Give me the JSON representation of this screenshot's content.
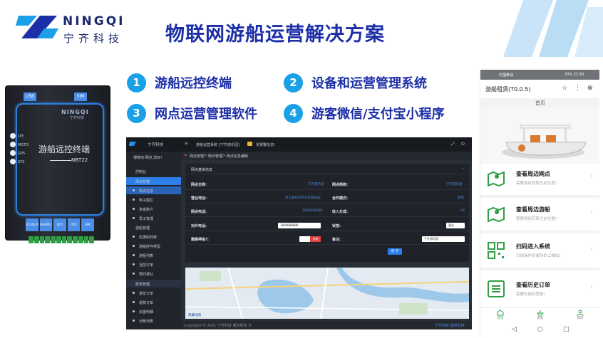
{
  "brand": {
    "name_en": "NINGQI",
    "name_cn": "宁齐科技"
  },
  "title": "物联网游船运营解决方案",
  "colors": {
    "accent": "#1c2fa6",
    "badge": "#1aa0e6",
    "green": "#2f9e44",
    "blue": "#2d7ee8"
  },
  "features": [
    {
      "num": "1",
      "label": "游船远控终端"
    },
    {
      "num": "2",
      "label": "设备和运营管理系统"
    },
    {
      "num": "3",
      "label": "网点运营管理软件"
    },
    {
      "num": "4",
      "label": "游客微信/支付宝小程序"
    }
  ],
  "device": {
    "ports": [
      "USB",
      "SIM"
    ],
    "brand": "NINGQI",
    "brand_sub": "宁齐科技",
    "name": "游船远控终端",
    "model": "NBT22",
    "leds": [
      "LTE",
      "MOTO",
      "GPS",
      "SYS"
    ],
    "bottom_labels": [
      "DC24V IN",
      "ALARM OUT",
      "DO1",
      "DO2",
      "EPK"
    ]
  },
  "web": {
    "logo_text": "宁齐科技",
    "system_title": "游船运营系统",
    "system_sub": "[宁齐游乐园]",
    "notice": "关报警信息!",
    "user": "傅移动-网点,您好!",
    "breadcrumb": [
      "网点管理",
      "网点管理",
      "网点信息编辑"
    ],
    "sidebar": [
      {
        "label": "控制台",
        "type": "group"
      },
      {
        "label": "网点管理",
        "type": "active"
      },
      {
        "label": "网点信息",
        "type": "sub-active"
      },
      {
        "label": "电子围栏",
        "type": "sub"
      },
      {
        "label": "资金账户",
        "type": "sub"
      },
      {
        "label": "员工管理",
        "type": "sub"
      },
      {
        "label": "游船管理",
        "type": "group"
      },
      {
        "label": "优惠码列表",
        "type": "sub"
      },
      {
        "label": "游船控件类型",
        "type": "sub"
      },
      {
        "label": "游船列表",
        "type": "sub"
      },
      {
        "label": "当前订单",
        "type": "sub"
      },
      {
        "label": "预约排队",
        "type": "sub"
      },
      {
        "label": "财务管理",
        "type": "group-hl"
      },
      {
        "label": "游览订单",
        "type": "sub"
      },
      {
        "label": "退款订单",
        "type": "sub"
      },
      {
        "label": "资金明细",
        "type": "sub"
      },
      {
        "label": "分账列表",
        "type": "sub"
      }
    ],
    "panel_title": "网点基本信息",
    "fields": {
      "full_name_label": "网点全称:",
      "full_name_value": "宁齐游乐园",
      "short_name_label": "网点简称:",
      "short_name_value": "宁齐游乐园",
      "address_label": "营业地址:",
      "address_value": "浙江省杭州市宁齐游乐园",
      "coop_label": "合作模式:",
      "coop_value": "独营",
      "phone_label": "网点电话:",
      "phone_value": "1888888888",
      "split_label": "收入分成:",
      "split_value": "99",
      "ext_phone_label": "对外电话:",
      "ext_phone_value": "1888888888",
      "status_label": "状态:",
      "status_value": "营业",
      "deposit_label": "需要押金?:",
      "deposit_value": "关闭",
      "remark_label": "备注:",
      "remark_value": "宁齐游乐园"
    },
    "save_button": "保 存",
    "map_label": "隐藏地图",
    "footer": "Copyright © 2021 宁齐科技 版权所有 ®",
    "footer_right": "宁齐科技 提供支持"
  },
  "phone": {
    "status_left": "中国移动",
    "status_right": "70%  21:30",
    "app_title": "游船租赁(T0.0.5)",
    "tab_home": "首页",
    "menu": [
      {
        "title": "查看周边网点",
        "subtitle": "需要授权获取当前位置!",
        "icon": "map-pin-icon"
      },
      {
        "title": "查看周边游船",
        "subtitle": "需要授权获取当前位置!",
        "icon": "map-boat-icon"
      },
      {
        "title": "扫码进入系统",
        "subtitle": "扫描操作船或所的二维码!",
        "icon": "qrcode-icon"
      },
      {
        "title": "查看历史订单",
        "subtitle": "需要先授权登录!",
        "icon": "list-icon"
      }
    ],
    "tabbar": [
      "首页",
      "游船",
      "我的"
    ]
  }
}
